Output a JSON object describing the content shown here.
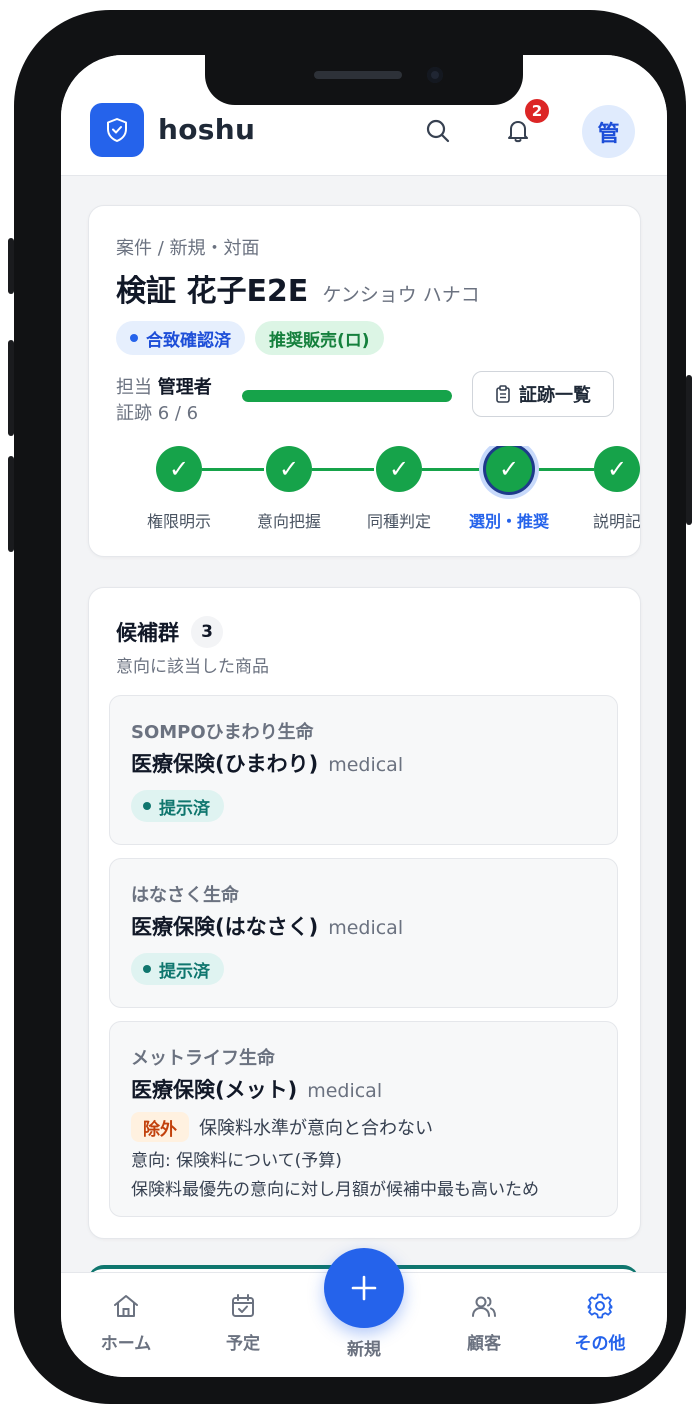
{
  "header": {
    "brand": "hoshu",
    "notification_count": "2",
    "avatar_initial": "管"
  },
  "case": {
    "breadcrumb": "案件 / 新規・対面",
    "customer_name": "検証 花子E2E",
    "customer_kana": "ケンショウ ハナコ",
    "badges": [
      {
        "label": "合致確認済",
        "color": "#1d4ed8"
      },
      {
        "label": "推奨販売(ロ)",
        "color": "#15803d"
      }
    ],
    "assignee_label": "担当",
    "assignee_name": "管理者",
    "evidence_text": "証跡 6 / 6",
    "evidence_progress": 1.0,
    "evidence_button": "証跡一覧",
    "steps": [
      {
        "label": "権限明示",
        "done": true,
        "active": false
      },
      {
        "label": "意向把握",
        "done": true,
        "active": false
      },
      {
        "label": "同種判定",
        "done": true,
        "active": false
      },
      {
        "label": "選別・推奨",
        "done": true,
        "active": true
      },
      {
        "label": "説明記",
        "done": true,
        "active": false
      }
    ]
  },
  "candidates": {
    "title": "候補群",
    "count": "3",
    "subtitle": "意向に該当した商品",
    "items": [
      {
        "company": "SOMPOひまわり生命",
        "product": "医療保険(ひまわり)",
        "category": "medical",
        "status": "提示済"
      },
      {
        "company": "はなさく生命",
        "product": "医療保険(はなさく)",
        "category": "medical",
        "status": "提示済"
      },
      {
        "company": "メットライフ生命",
        "product": "医療保険(メット)",
        "category": "medical",
        "exclude_tag": "除外",
        "exclude_reason": "保険料水準が意向と合わない",
        "intent": "意向: 保険料について(予算)",
        "note": "保険料最優先の意向に対し月額が候補中最も高いため"
      }
    ]
  },
  "tabbar": {
    "home": "ホーム",
    "schedule": "予定",
    "new": "新規",
    "customers": "顧客",
    "other": "その他",
    "active": "other"
  },
  "colors": {
    "primary": "#2563eb",
    "success": "#16a34a",
    "teal": "#0f766e",
    "warning": "#c2410c"
  }
}
